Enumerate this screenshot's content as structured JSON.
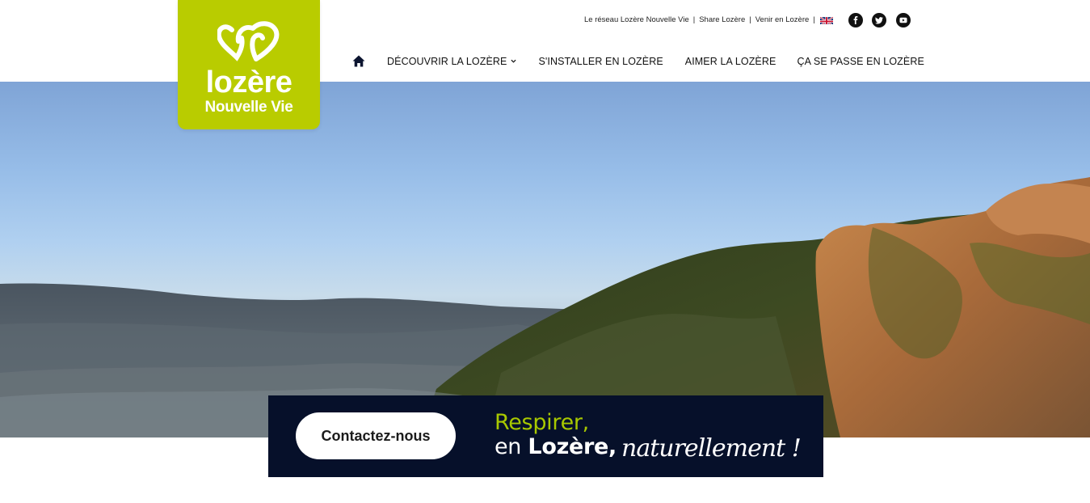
{
  "brand": {
    "name_line1": "lozère",
    "name_line2": "Nouvelle Vie",
    "color": "#b9cc00"
  },
  "top_links": [
    {
      "label": "Le réseau Lozère Nouvelle Vie"
    },
    {
      "label": "Share Lozère"
    },
    {
      "label": "Venir en Lozère"
    }
  ],
  "language_flag": "uk-flag-icon",
  "social": [
    "facebook-icon",
    "twitter-icon",
    "youtube-icon"
  ],
  "nav": {
    "home_icon": "home-icon",
    "items": [
      {
        "label": "DÉCOUVRIR LA LOZÈRE",
        "has_dropdown": true
      },
      {
        "label": "S'INSTALLER EN LOZÈRE"
      },
      {
        "label": "AIMER LA LOZÈRE"
      },
      {
        "label": "ÇA SE PASSE EN LOZÈRE"
      }
    ]
  },
  "banner": {
    "button_label": "Contactez-nous",
    "line1": "Respirer,",
    "line2_prefix": "en",
    "line2_bold": "Lozère,",
    "line3": "naturellement !",
    "background": "#06102a",
    "accent": "#a8c800"
  }
}
